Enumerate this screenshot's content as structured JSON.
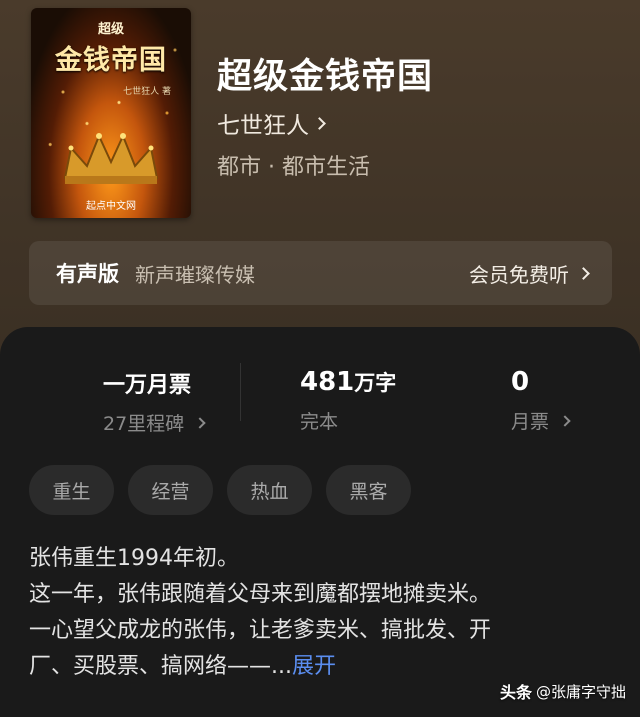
{
  "book": {
    "cover": {
      "small_text": "超级",
      "title_text": "金钱帝国",
      "author_text": "七世狂人 著",
      "brand_text": "起点中文网"
    },
    "title": "超级金钱帝国",
    "author": "七世狂人",
    "genre": "都市 · 都市生活"
  },
  "audio": {
    "label": "有声版",
    "publisher": "新声璀璨传媒",
    "cta": "会员免费听"
  },
  "stats": [
    {
      "value": "一万月票",
      "sub": "27里程碑"
    },
    {
      "value": "481",
      "unit": "万字",
      "sub": "完本"
    },
    {
      "value": "0",
      "sub": "月票"
    }
  ],
  "tags": [
    "重生",
    "经营",
    "热血",
    "黑客"
  ],
  "synopsis": {
    "lines": [
      "张伟重生1994年初。",
      "这一年，张伟跟随着父母来到魔都摆地摊卖米。",
      "一心望父成龙的张伟，让老爹卖米、搞批发、开",
      "厂、买股票、搞网络——..."
    ],
    "expand_label": "展开"
  },
  "watermark": {
    "brand": "头条",
    "handle": "@张庸字守拙"
  },
  "colors": {
    "header_bg": "#443628",
    "panel_bg": "#1a1a1a",
    "tag_bg": "#2b2b2b",
    "link_blue": "#5b8ef0"
  }
}
